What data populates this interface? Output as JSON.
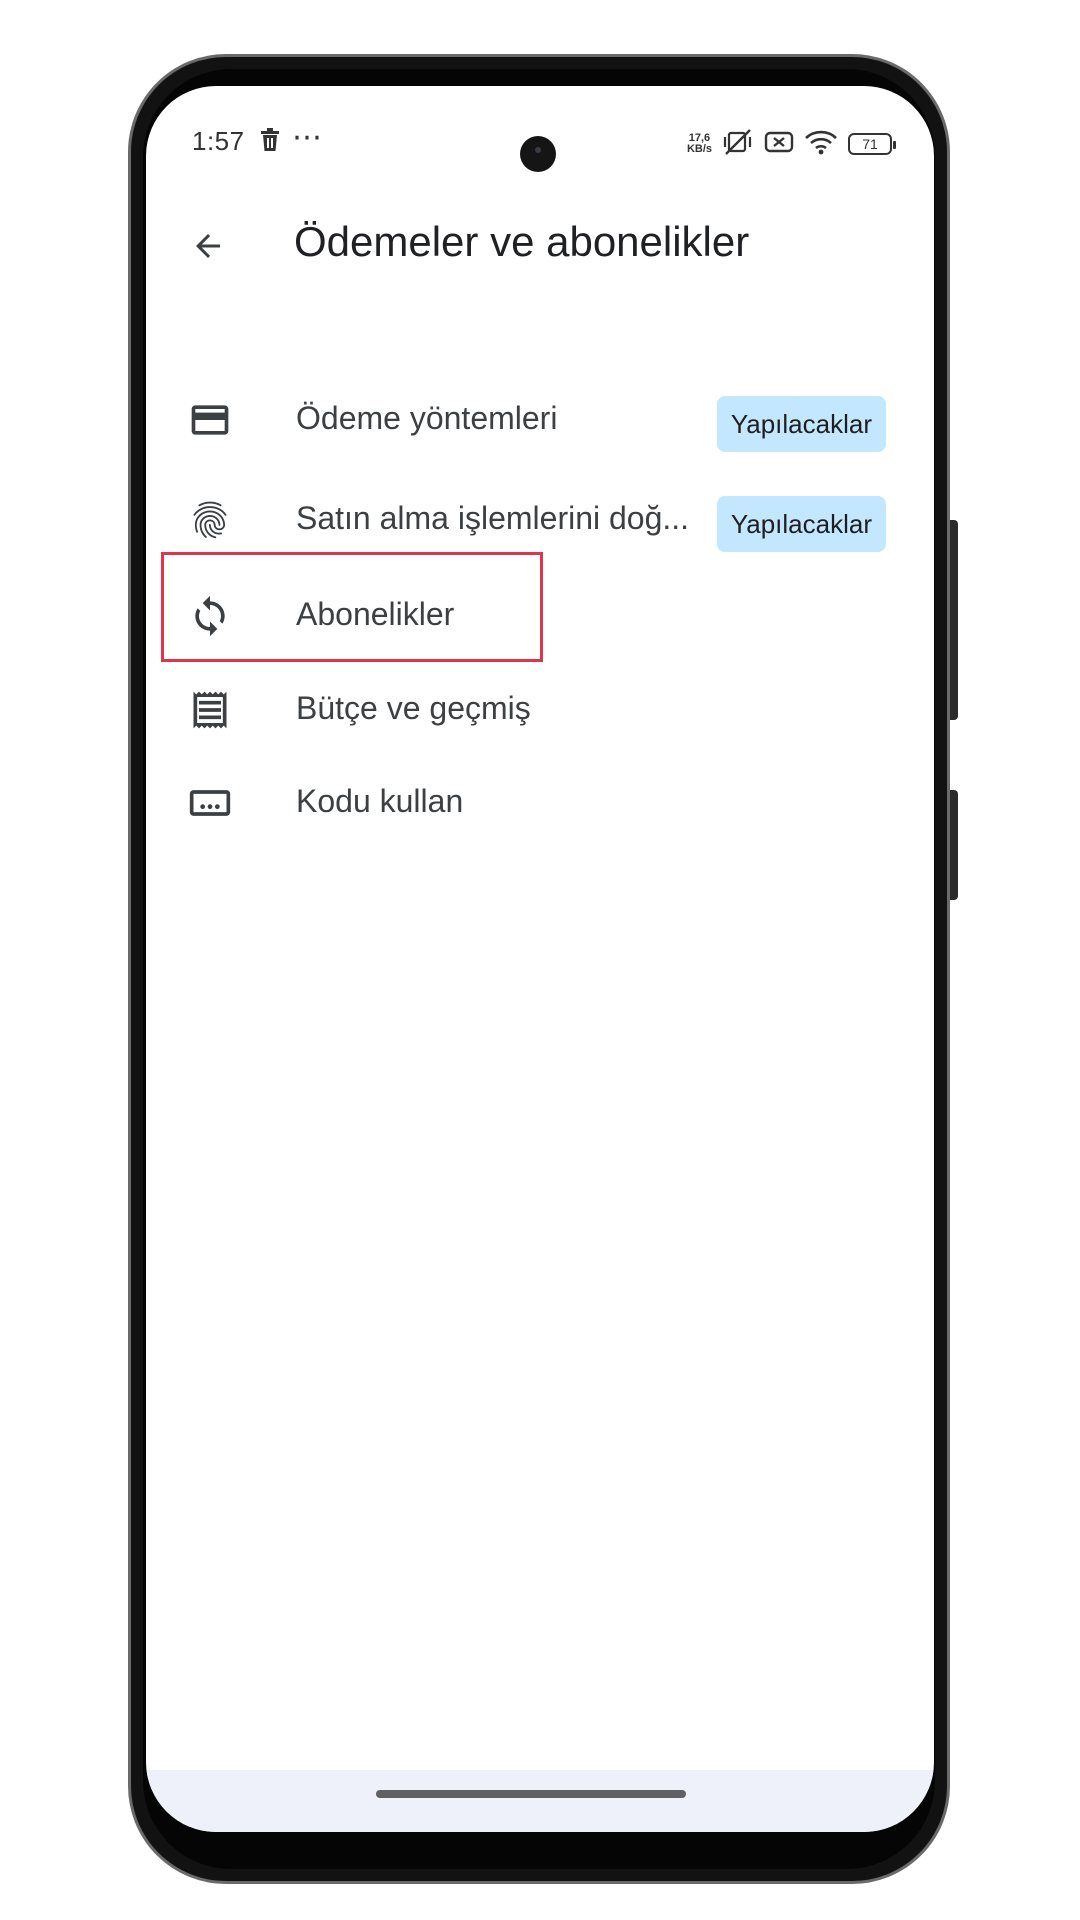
{
  "status_bar": {
    "time": "1:57",
    "left_icons": [
      "trash-icon",
      "more-dots-icon"
    ],
    "more_dots": "⋯",
    "net_speed_value": "17,6",
    "net_speed_unit": "KB/s",
    "battery_level": "71"
  },
  "header": {
    "title": "Ödemeler ve abonelikler"
  },
  "menu": {
    "items": [
      {
        "label": "Ödeme yöntemleri",
        "icon": "credit-card-icon",
        "badge": "Yapılacaklar"
      },
      {
        "label": "Satın alma işlemlerini doğ...",
        "icon": "fingerprint-icon",
        "badge": "Yapılacaklar"
      },
      {
        "label": "Abonelikler",
        "icon": "sync-icon",
        "highlighted": true
      },
      {
        "label": "Bütçe ve geçmiş",
        "icon": "receipt-icon"
      },
      {
        "label": "Kodu kullan",
        "icon": "redeem-code-icon"
      }
    ]
  },
  "colors": {
    "badge_bg": "#c2e7ff",
    "highlight": "#e0344e",
    "text": "#3c4043"
  }
}
